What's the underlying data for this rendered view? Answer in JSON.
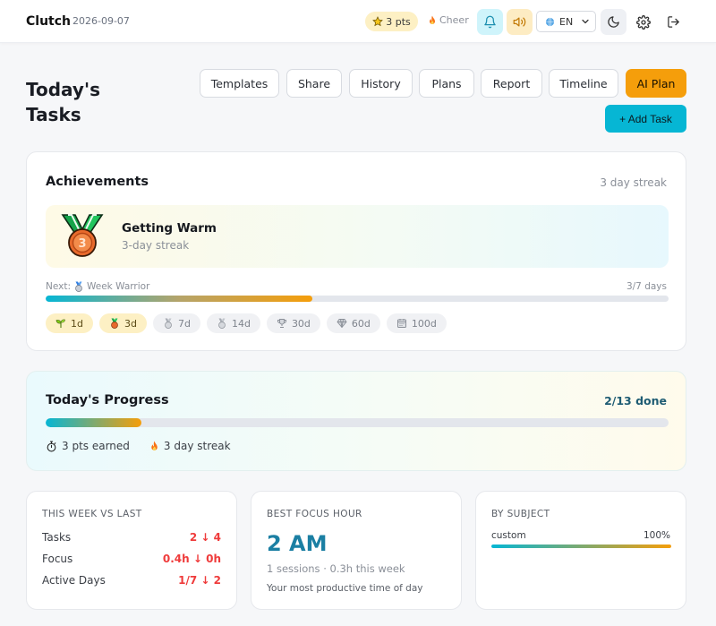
{
  "header": {
    "brand": "Clutch",
    "date": "2026-09-07",
    "points": "3 pts",
    "cheer": "Cheer",
    "language": "EN"
  },
  "page": {
    "title": "Today's Tasks",
    "buttons": [
      "Templates",
      "Share",
      "History",
      "Plans",
      "Report",
      "Timeline",
      "AI Plan"
    ],
    "add_task": "+ Add Task"
  },
  "achievements": {
    "title": "Achievements",
    "streak": "3 day streak",
    "current": {
      "name": "Getting Warm",
      "subtitle": "3-day streak",
      "medal_number": "3"
    },
    "next_prefix": "Next:",
    "next_name": "Week Warrior",
    "next_progress": "3/7 days",
    "progress_fraction": 0.4286,
    "milestones": [
      {
        "label": "1d",
        "icon": "sprout-icon",
        "achieved": true
      },
      {
        "label": "3d",
        "icon": "bronze-medal-icon",
        "achieved": true
      },
      {
        "label": "7d",
        "icon": "medal-icon",
        "achieved": false
      },
      {
        "label": "14d",
        "icon": "medal-icon",
        "achieved": false
      },
      {
        "label": "30d",
        "icon": "trophy-icon",
        "achieved": false
      },
      {
        "label": "60d",
        "icon": "gem-icon",
        "achieved": false
      },
      {
        "label": "100d",
        "icon": "calendar-icon",
        "achieved": false
      }
    ]
  },
  "progress": {
    "title": "Today's Progress",
    "done": "2/13 done",
    "fraction": 0.1538,
    "points_earned": "3 pts earned",
    "streak": "3 day streak"
  },
  "week_vs_last": {
    "label": "THIS WEEK VS LAST",
    "rows": [
      {
        "name": "Tasks",
        "value": "2 ↓ 4"
      },
      {
        "name": "Focus",
        "value": "0.4h ↓ 0h"
      },
      {
        "name": "Active Days",
        "value": "1/7 ↓ 2"
      }
    ]
  },
  "best_focus": {
    "label": "BEST FOCUS HOUR",
    "value": "2 AM",
    "sub": "1 sessions · 0.3h this week",
    "note": "Your most productive time of day"
  },
  "by_subject": {
    "label": "BY SUBJECT",
    "subject": "custom",
    "percent": "100%",
    "fraction": 1.0
  },
  "colors": {
    "accent_cyan": "#06b6d4",
    "accent_amber": "#f59e0b",
    "negative": "#ef3b3b"
  }
}
